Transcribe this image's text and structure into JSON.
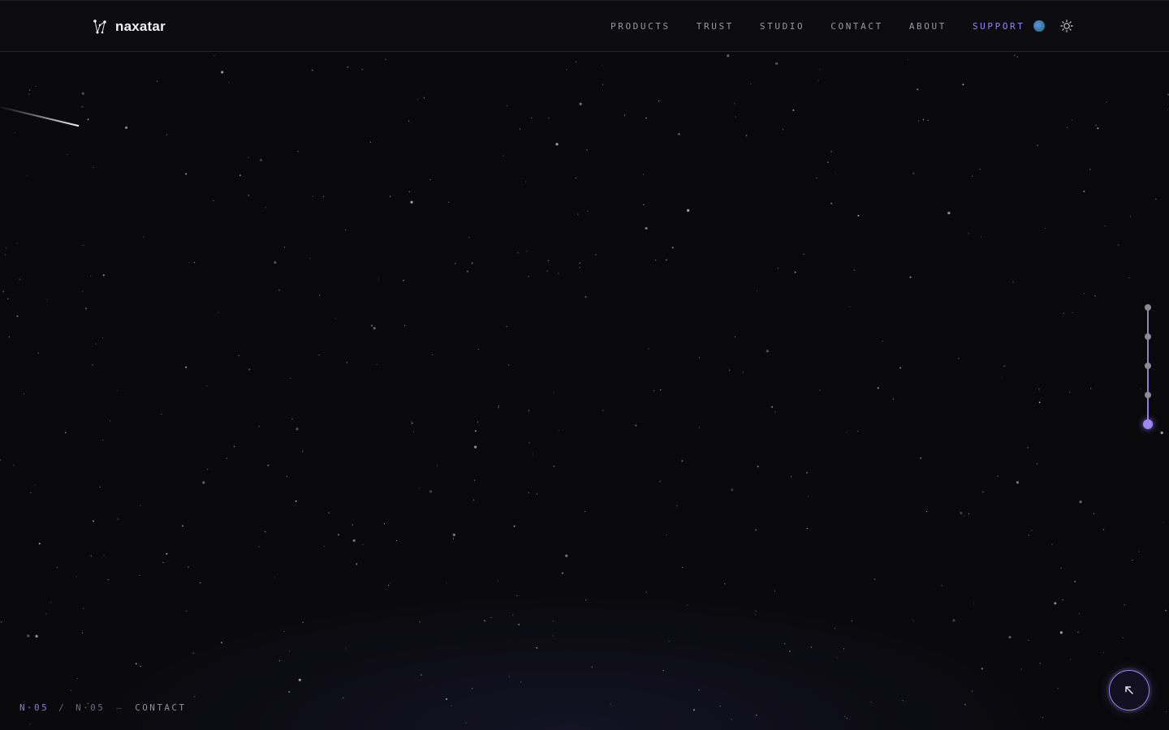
{
  "brand": {
    "name": "naxatar",
    "logo_icon": "constellation-icon"
  },
  "nav": {
    "items": [
      {
        "label": "PRODUCTS"
      },
      {
        "label": "TRUST"
      },
      {
        "label": "STUDIO"
      },
      {
        "label": "CONTACT"
      },
      {
        "label": "ABOUT"
      },
      {
        "label": "SUPPORT",
        "active": true
      }
    ]
  },
  "header_icons": {
    "language": "globe-icon",
    "theme": "sun-icon"
  },
  "section_rail": {
    "total": 5,
    "active_index": 5
  },
  "footer": {
    "current": "N·05",
    "separator": "/",
    "total": "N·05",
    "dash": "—",
    "section": "CONTACT"
  },
  "back_to_top": {
    "icon": "arrow-up-left-icon"
  },
  "colors": {
    "background": "#09090c",
    "accent": "#9b87f5",
    "nav_text": "#9a9aa6"
  }
}
